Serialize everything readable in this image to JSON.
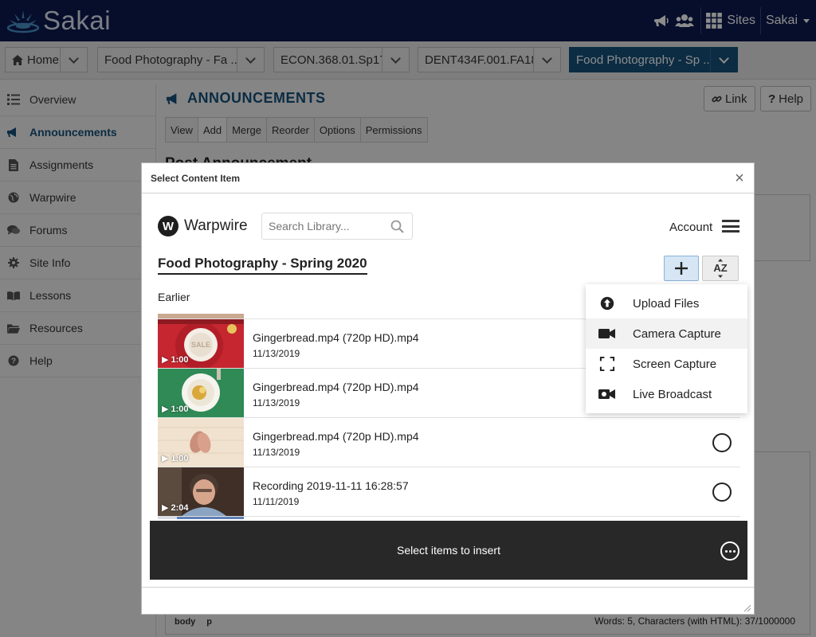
{
  "header": {
    "logo_text": "Sakai",
    "sites_label": "Sites",
    "user_label": "Sakai"
  },
  "site_tabs": [
    {
      "label": "Home"
    },
    {
      "label": "Food Photography - Fa ..."
    },
    {
      "label": "ECON.368.01.Sp17"
    },
    {
      "label": "DENT434F.001.FA18"
    },
    {
      "label": "Food Photography - Sp ..."
    }
  ],
  "left_nav": [
    {
      "label": "Overview",
      "icon": "list-icon"
    },
    {
      "label": "Announcements",
      "icon": "megaphone-icon"
    },
    {
      "label": "Assignments",
      "icon": "document-icon"
    },
    {
      "label": "Warpwire",
      "icon": "globe-icon"
    },
    {
      "label": "Forums",
      "icon": "chat-icon"
    },
    {
      "label": "Site Info",
      "icon": "gear-icon"
    },
    {
      "label": "Lessons",
      "icon": "book-icon"
    },
    {
      "label": "Resources",
      "icon": "folder-icon"
    },
    {
      "label": "Help",
      "icon": "help-icon"
    }
  ],
  "tool": {
    "title": "ANNOUNCEMENTS",
    "link_label": "Link",
    "help_label": "Help",
    "tabs": [
      "View",
      "Add",
      "Merge",
      "Reorder",
      "Options",
      "Permissions"
    ],
    "post_heading": "Post Announcement",
    "path_body": "body",
    "path_p": "p",
    "word_count": "Words: 5, Characters (with HTML): 37/1000000"
  },
  "modal": {
    "title": "Select Content Item",
    "close": "×"
  },
  "warpwire": {
    "logo_letter": "W",
    "brand": "Warpwire",
    "search_placeholder": "Search Library...",
    "account_label": "Account",
    "library_title": "Food Photography - Spring 2020",
    "sort_label": "AZ",
    "section_label": "Earlier",
    "items": [
      {
        "title": "Gingerbread.mp4 (720p HD).mp4",
        "date": "11/13/2019",
        "duration": "▶ 1:00",
        "thumb_text": "SALE"
      },
      {
        "title": "Gingerbread.mp4 (720p HD).mp4",
        "date": "11/13/2019",
        "duration": "▶ 1:00"
      },
      {
        "title": "Gingerbread.mp4 (720p HD).mp4",
        "date": "11/13/2019",
        "duration": "▶ 1:00"
      },
      {
        "title": "Recording 2019-11-11 16:28:57",
        "date": "11/11/2019",
        "duration": "▶ 2:04"
      }
    ],
    "insert_label": "Select items to insert",
    "add_menu": [
      {
        "label": "Upload Files",
        "icon": "upload-icon"
      },
      {
        "label": "Camera Capture",
        "icon": "video-camera-icon"
      },
      {
        "label": "Screen Capture",
        "icon": "screen-capture-icon"
      },
      {
        "label": "Live Broadcast",
        "icon": "live-broadcast-icon"
      }
    ]
  },
  "colors": {
    "header_bg": "#0c1a4f",
    "accent": "#15507a",
    "insert_bar": "#282828"
  }
}
